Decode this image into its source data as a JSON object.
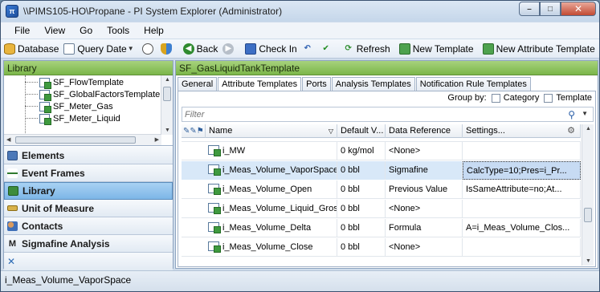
{
  "window": {
    "title": "\\\\PIMS105-HO\\Propane - PI System Explorer (Administrator)",
    "controls": {
      "minimize": "–",
      "maximize": "□",
      "close": "✕"
    }
  },
  "menu": [
    "File",
    "View",
    "Go",
    "Tools",
    "Help"
  ],
  "toolbar": {
    "database": "Database",
    "query_date": "Query Date",
    "back": "Back",
    "check_in": "Check In",
    "refresh": "Refresh",
    "new_template": "New Template",
    "new_attribute_template": "New Attribute Template"
  },
  "library": {
    "header": "Library",
    "tree_items": [
      "SF_FlowTemplate",
      "SF_GlobalFactorsTemplate",
      "SF_Meter_Gas",
      "SF_Meter_Liquid"
    ]
  },
  "nav": {
    "elements": "Elements",
    "event_frames": "Event Frames",
    "library": "Library",
    "unit_of_measure": "Unit of Measure",
    "contacts": "Contacts",
    "sigmafine": "Sigmafine Analysis"
  },
  "right": {
    "header": "SF_GasLiquidTankTemplate",
    "tabs": [
      "General",
      "Attribute Templates",
      "Ports",
      "Analysis Templates",
      "Notification Rule Templates"
    ],
    "active_tab": "Attribute Templates",
    "group_by": "Group by:",
    "category": "Category",
    "template": "Template",
    "filter_placeholder": "Filter",
    "columns": {
      "name": "Name",
      "default_value": "Default V...",
      "data_reference": "Data Reference",
      "settings": "Settings..."
    },
    "rows": [
      {
        "name": "i_MW",
        "default": "0 kg/mol",
        "dataref": "<None>",
        "settings": ""
      },
      {
        "name": "i_Meas_Volume_VaporSpace",
        "default": "0 bbl",
        "dataref": "Sigmafine",
        "settings": "CalcType=10;Pres=i_Pr..."
      },
      {
        "name": "i_Meas_Volume_Open",
        "default": "0 bbl",
        "dataref": "Previous Value",
        "settings": "IsSameAttribute=no;At..."
      },
      {
        "name": "i_Meas_Volume_Liquid_Gross",
        "default": "0 bbl",
        "dataref": "<None>",
        "settings": ""
      },
      {
        "name": "i_Meas_Volume_Delta",
        "default": "0 bbl",
        "dataref": "Formula",
        "settings": "A=i_Meas_Volume_Clos..."
      },
      {
        "name": "i_Meas_Volume_Close",
        "default": "0 bbl",
        "dataref": "<None>",
        "settings": ""
      }
    ],
    "selected_row": 1
  },
  "status": {
    "text": "i_Meas_Volume_VaporSpace"
  },
  "colors": {
    "pane_header": "#7bb64a",
    "selection": "#d8e8f8",
    "nav_active": "#7db6e7"
  }
}
